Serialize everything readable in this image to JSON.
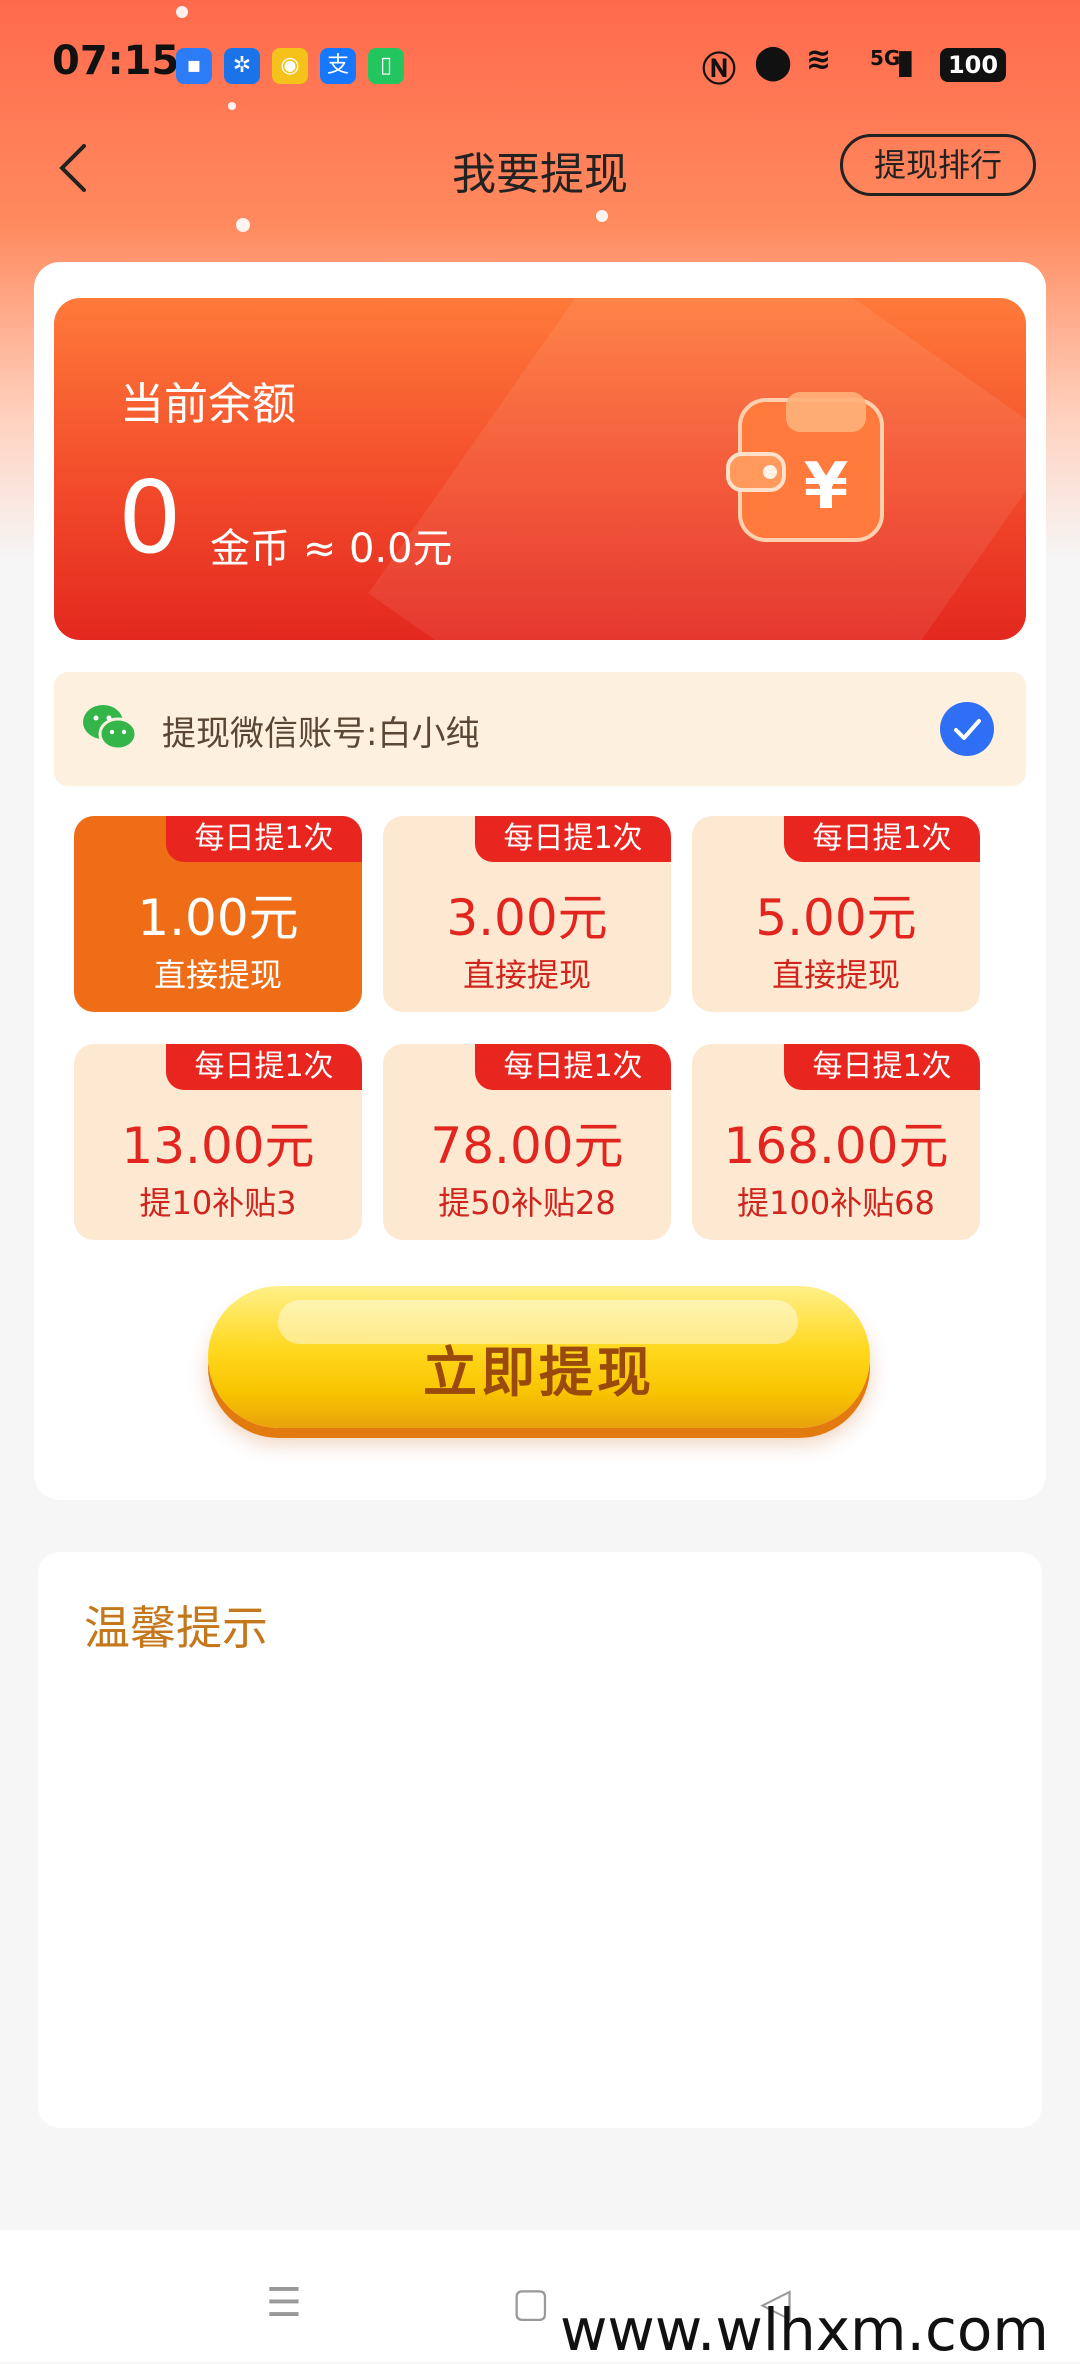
{
  "status_bar": {
    "time": "07:15",
    "network": "5G",
    "battery": "100"
  },
  "header": {
    "title": "我要提现",
    "rank_button": "提现排行"
  },
  "balance": {
    "label": "当前余额",
    "coins": "0",
    "unit_text": "金币 ≈ 0.0元"
  },
  "account": {
    "text": "提现微信账号:白小纯"
  },
  "options": [
    {
      "tag": "每日提1次",
      "amount": "1.00元",
      "sub": "直接提现",
      "selected": true
    },
    {
      "tag": "每日提1次",
      "amount": "3.00元",
      "sub": "直接提现",
      "selected": false
    },
    {
      "tag": "每日提1次",
      "amount": "5.00元",
      "sub": "直接提现",
      "selected": false
    },
    {
      "tag": "每日提1次",
      "amount": "13.00元",
      "sub": "提10补贴3",
      "selected": false
    },
    {
      "tag": "每日提1次",
      "amount": "78.00元",
      "sub": "提50补贴28",
      "selected": false
    },
    {
      "tag": "每日提1次",
      "amount": "168.00元",
      "sub": "提100补贴68",
      "selected": false
    }
  ],
  "cta": {
    "label": "立即提现"
  },
  "tips": {
    "title": "温馨提示"
  },
  "navbar": {
    "menu_icon": "☰",
    "home_icon": "▢",
    "back_icon": "◁"
  },
  "watermark": "www.wlhxm.com",
  "colors": {
    "accent": "#e8251f",
    "selected": "#ee6d16",
    "cta": "#ffd81e"
  }
}
